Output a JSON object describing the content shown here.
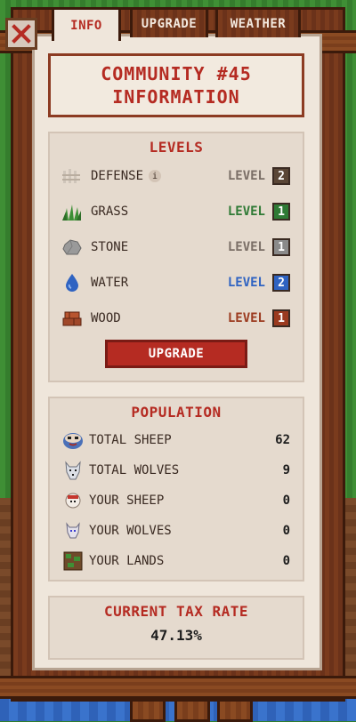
{
  "tabs": [
    {
      "label": "INFO",
      "active": true
    },
    {
      "label": "UPGRADE",
      "active": false
    },
    {
      "label": "WEATHER",
      "active": false
    }
  ],
  "title": {
    "line1": "COMMUNITY #45",
    "line2": "INFORMATION"
  },
  "levels": {
    "title": "LEVELS",
    "items": [
      {
        "name": "DEFENSE",
        "icon": "fence-icon",
        "level_label": "LEVEL",
        "level": "2",
        "color": "#5a4636"
      },
      {
        "name": "GRASS",
        "icon": "grass-icon",
        "level_label": "LEVEL",
        "level": "1",
        "color": "#2f7a35"
      },
      {
        "name": "STONE",
        "icon": "stone-icon",
        "level_label": "LEVEL",
        "level": "1",
        "color": "#7f7f7f"
      },
      {
        "name": "WATER",
        "icon": "water-drop-icon",
        "level_label": "LEVEL",
        "level": "2",
        "color": "#2f63c2"
      },
      {
        "name": "WOOD",
        "icon": "wood-icon",
        "level_label": "LEVEL",
        "level": "1",
        "color": "#9b3a1f"
      }
    ],
    "upgrade_button": "UPGRADE"
  },
  "population": {
    "title": "POPULATION",
    "rows": [
      {
        "label": "TOTAL SHEEP",
        "value": "62",
        "icon": "sheep-face-icon"
      },
      {
        "label": "TOTAL WOLVES",
        "value": "9",
        "icon": "wolf-icon"
      },
      {
        "label": "YOUR SHEEP",
        "value": "0",
        "icon": "sheep-icon"
      },
      {
        "label": "YOUR WOLVES",
        "value": "0",
        "icon": "small-wolf-icon"
      },
      {
        "label": "YOUR LANDS",
        "value": "0",
        "icon": "land-icon"
      }
    ]
  },
  "tax": {
    "title": "CURRENT TAX RATE",
    "value": "47.13%"
  },
  "colors": {
    "accent": "#b52b22",
    "panel": "#efe6db",
    "wood": "#7a3b1d"
  }
}
